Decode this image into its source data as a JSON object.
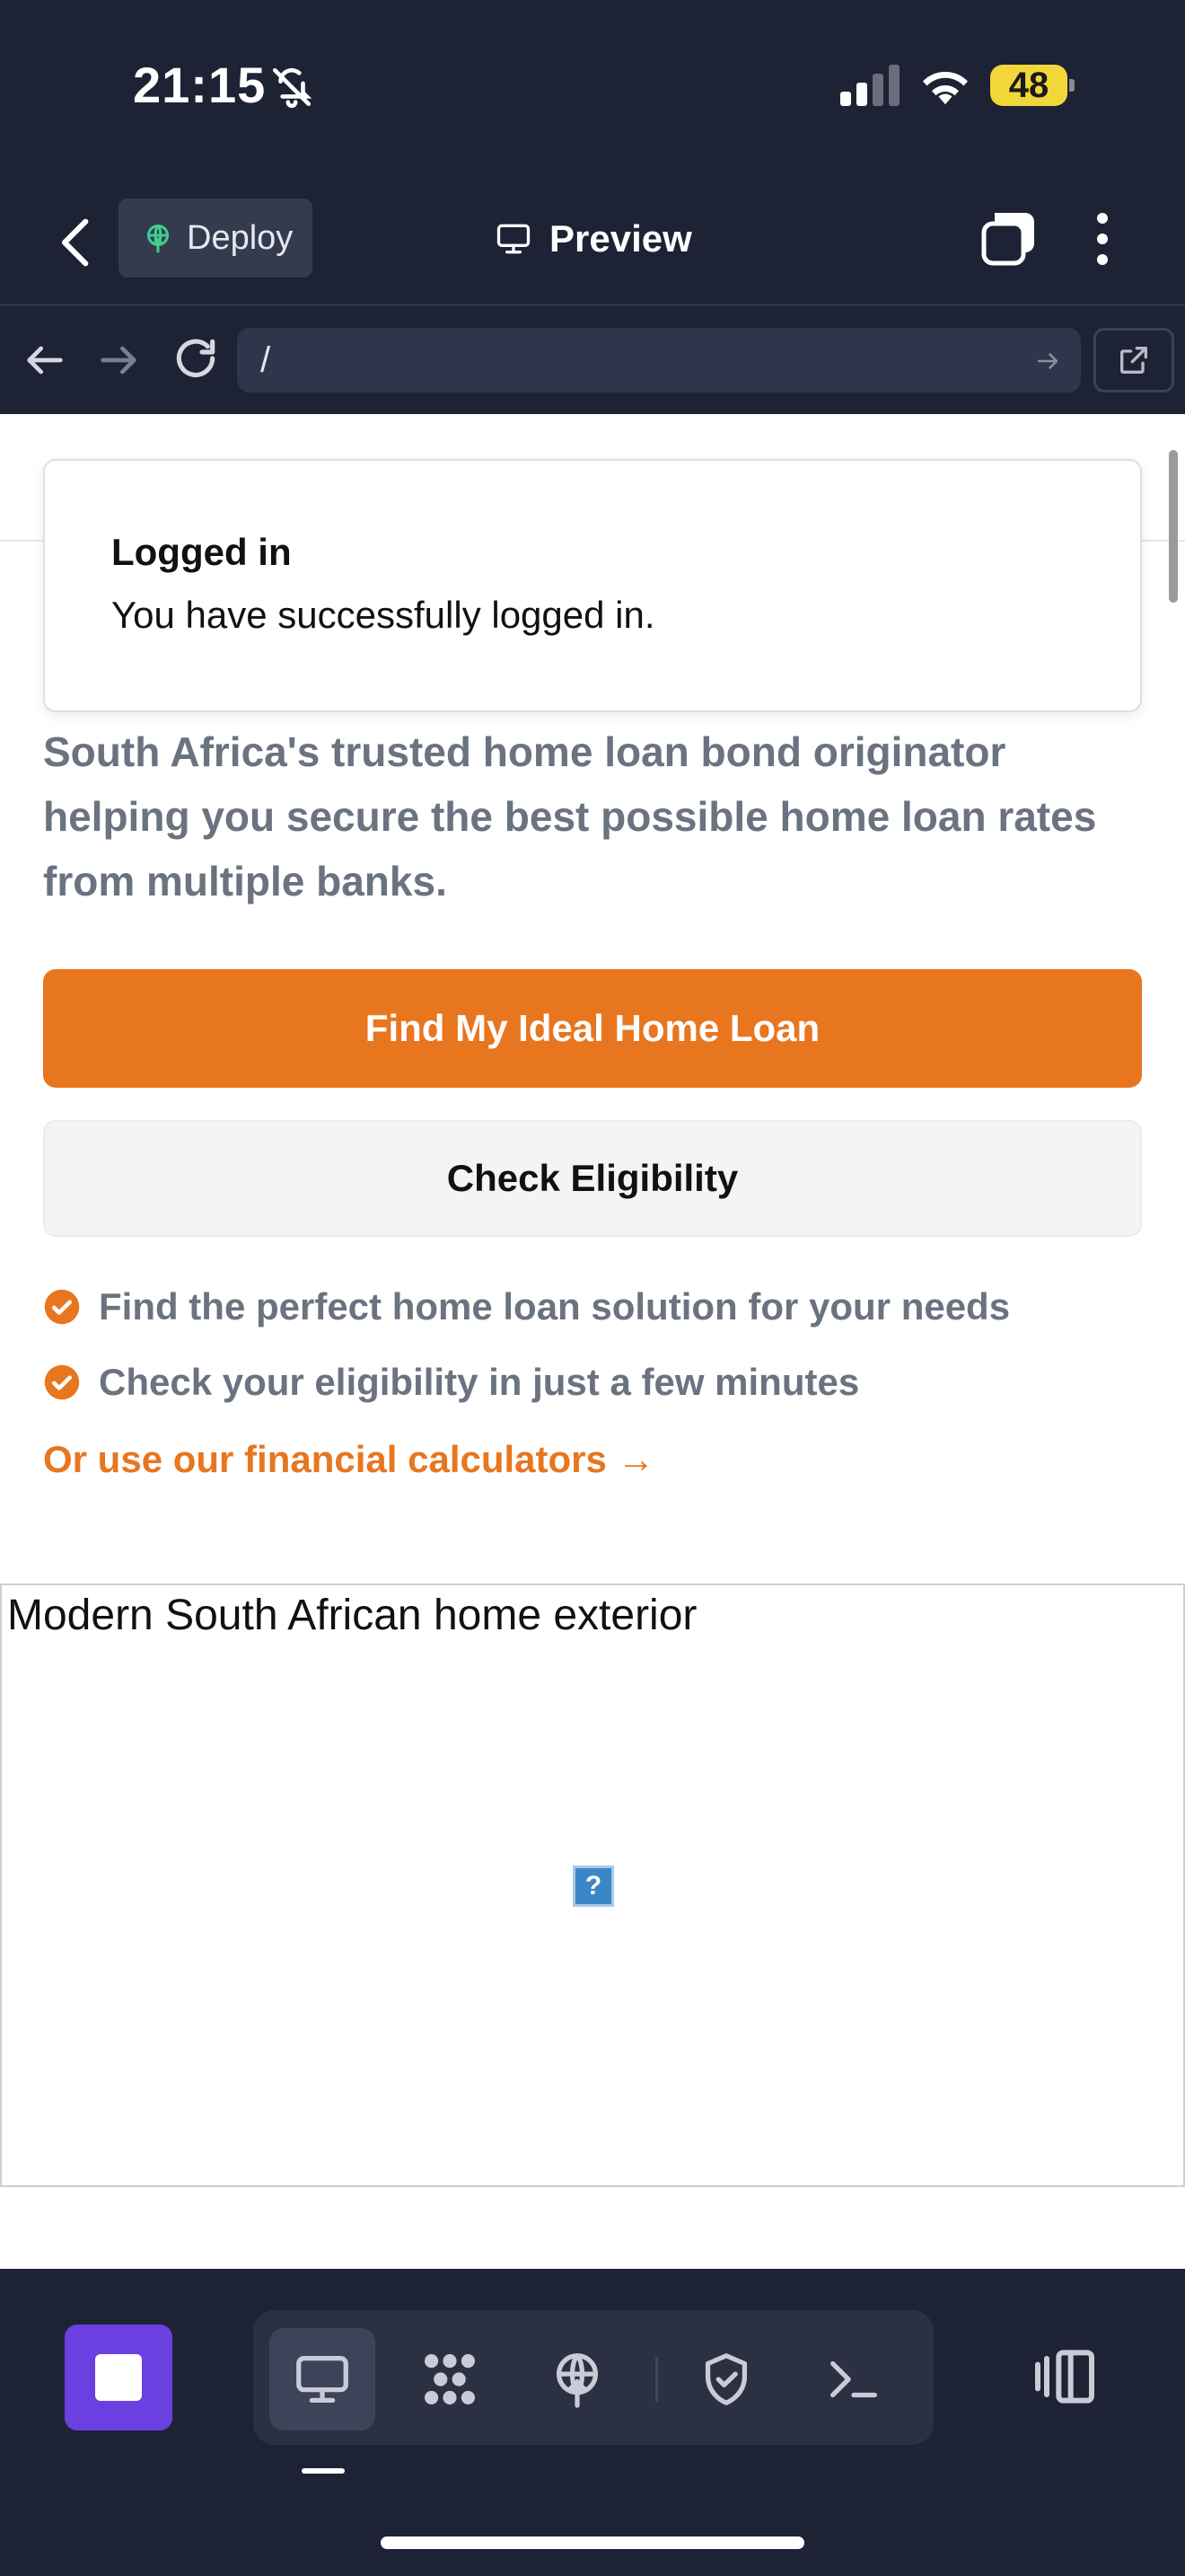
{
  "status_bar": {
    "time": "21:15",
    "battery": "48"
  },
  "header": {
    "deploy_label": "Deploy",
    "preview_label": "Preview"
  },
  "browser": {
    "url": "/"
  },
  "toast": {
    "title": "Logged in",
    "message": "You have successfully logged in."
  },
  "hero": {
    "description": "South Africa's trusted home loan bond originator helping you secure the best possible home loan rates from multiple banks.",
    "primary_cta": "Find My Ideal Home Loan",
    "secondary_cta": "Check Eligibility",
    "features": [
      "Find the perfect home loan solution for your needs",
      "Check your eligibility in just a few minutes"
    ],
    "calculators_link": "Or use our financial calculators →",
    "image_alt": "Modern South African home exterior",
    "broken_image_glyph": "?"
  },
  "colors": {
    "accent": "#e8761f",
    "background": "#1e2235",
    "stop_button": "#6b3fe0"
  }
}
